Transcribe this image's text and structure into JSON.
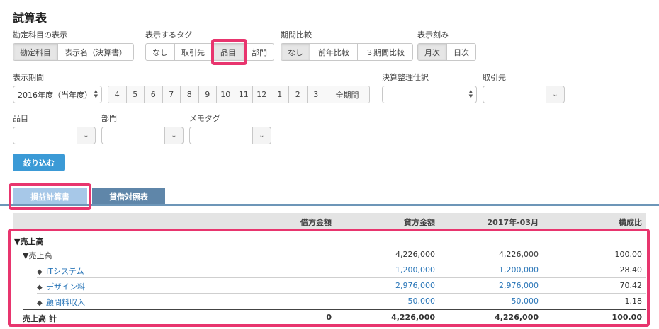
{
  "page": {
    "title": "試算表"
  },
  "filters": {
    "account_display": {
      "label": "勘定科目の表示",
      "options": [
        "勘定科目",
        "表示名（決算書）"
      ],
      "active": "勘定科目"
    },
    "tag_display": {
      "label": "表示するタグ",
      "options": [
        "なし",
        "取引先",
        "品目",
        "部門"
      ],
      "active": "品目"
    },
    "period_compare": {
      "label": "期間比較",
      "options": [
        "なし",
        "前年比較",
        "３期間比較"
      ],
      "active": "なし"
    },
    "granularity": {
      "label": "表示刻み",
      "options": [
        "月次",
        "日次"
      ],
      "active": "月次"
    },
    "period": {
      "label": "表示期間",
      "selected": "2016年度（当年度）",
      "months": [
        "4",
        "5",
        "6",
        "7",
        "8",
        "9",
        "10",
        "11",
        "12",
        "1",
        "2",
        "3"
      ],
      "all_label": "全期間"
    },
    "closing": {
      "label": "決算整理仕訳",
      "selected": ""
    },
    "partner": {
      "label": "取引先"
    },
    "item": {
      "label": "品目"
    },
    "dept": {
      "label": "部門"
    },
    "memo_tag": {
      "label": "メモタグ"
    },
    "submit_label": "絞り込む"
  },
  "tabs": [
    {
      "label": "損益計算書",
      "active": true
    },
    {
      "label": "貸借対照表",
      "active": false
    }
  ],
  "table": {
    "headers": [
      "借方金額",
      "貸方金額",
      "2017年-03月",
      "構成比"
    ],
    "rows": [
      {
        "name": "▼売上高",
        "debit": "",
        "credit": "",
        "month": "",
        "ratio": ""
      },
      {
        "name": "▼売上高",
        "debit": "",
        "credit": "4,226,000",
        "month": "4,226,000",
        "ratio": "100.00"
      },
      {
        "name": "ITシステム",
        "debit": "",
        "credit": "1,200,000",
        "month": "1,200,000",
        "ratio": "28.40"
      },
      {
        "name": "デザイン料",
        "debit": "",
        "credit": "2,976,000",
        "month": "2,976,000",
        "ratio": "70.42"
      },
      {
        "name": "顧問料収入",
        "debit": "",
        "credit": "50,000",
        "month": "50,000",
        "ratio": "1.18"
      },
      {
        "name": "売上高 計",
        "debit": "0",
        "credit": "4,226,000",
        "month": "4,226,000",
        "ratio": "100.00"
      }
    ]
  },
  "colors": {
    "accent": "#3b9ad6",
    "highlight": "#e8356e",
    "link": "#2a76b8",
    "tab_active": "#a7c8e8",
    "tab_inactive": "#5f86a9"
  }
}
